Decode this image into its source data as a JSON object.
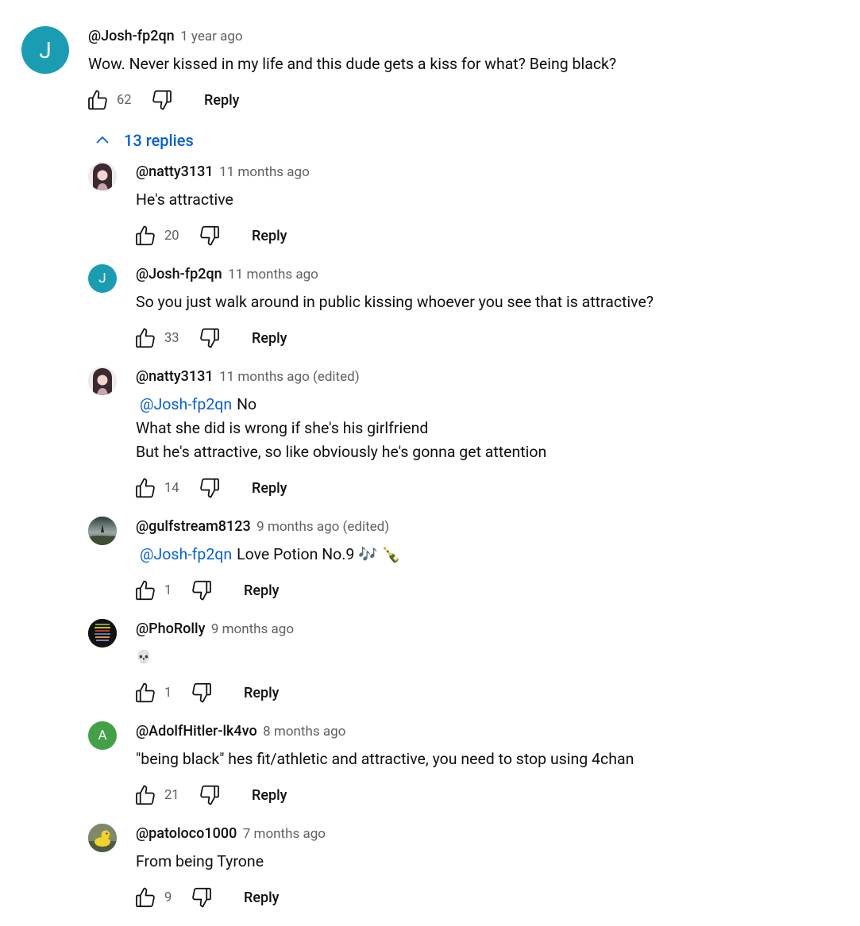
{
  "colors": {
    "link": "#065fd4",
    "secondary_text": "#606060"
  },
  "top_comment": {
    "author": "@Josh-fp2qn",
    "time": "1 year ago",
    "avatar_letter": "J",
    "avatar_color": "#1a9db2",
    "text": "Wow. Never kissed in my life and this dude gets a kiss for what? Being black?",
    "likes": "62",
    "reply_label": "Reply"
  },
  "replies_toggle": {
    "label": "13 replies",
    "icon": "chevron-up-icon"
  },
  "replies": [
    {
      "author": "@natty3131",
      "time": "11 months ago",
      "avatar": "image",
      "lines": [
        {
          "text": "He's attractive"
        }
      ],
      "likes": "20",
      "reply_label": "Reply"
    },
    {
      "author": "@Josh-fp2qn",
      "time": "11 months ago",
      "avatar_letter": "J",
      "avatar_color": "#1a9db2",
      "lines": [
        {
          "text": "So you just walk around in public kissing whoever you see that is attractive?"
        }
      ],
      "likes": "33",
      "reply_label": "Reply"
    },
    {
      "author": "@natty3131",
      "time": "11 months ago (edited)",
      "avatar": "image",
      "lines": [
        {
          "mention": "@Josh-fp2qn",
          "text": "No"
        },
        {
          "text": "What she did is wrong if she's his girlfriend"
        },
        {
          "text": "But he's attractive, so like obviously he's gonna get attention"
        }
      ],
      "likes": "14",
      "reply_label": "Reply"
    },
    {
      "author": "@gulfstream8123",
      "time": "9 months ago (edited)",
      "avatar": "image",
      "lines": [
        {
          "mention": "@Josh-fp2qn",
          "text": "Love Potion No.9 🎶 🍾"
        }
      ],
      "likes": "1",
      "reply_label": "Reply"
    },
    {
      "author": "@PhoRolly",
      "time": "9 months ago",
      "avatar": "image",
      "lines": [
        {
          "text": "💀"
        }
      ],
      "likes": "1",
      "reply_label": "Reply"
    },
    {
      "author": "@AdolfHitler-lk4vo",
      "time": "8 months ago",
      "avatar_letter": "A",
      "avatar_color": "#43a047",
      "lines": [
        {
          "text": "\"being black\" hes fit/athletic and attractive, you need to stop using 4chan"
        }
      ],
      "likes": "21",
      "reply_label": "Reply"
    },
    {
      "author": "@patoloco1000",
      "time": "7 months ago",
      "avatar": "image",
      "lines": [
        {
          "text": "From being Tyrone"
        }
      ],
      "likes": "9",
      "reply_label": "Reply"
    }
  ]
}
